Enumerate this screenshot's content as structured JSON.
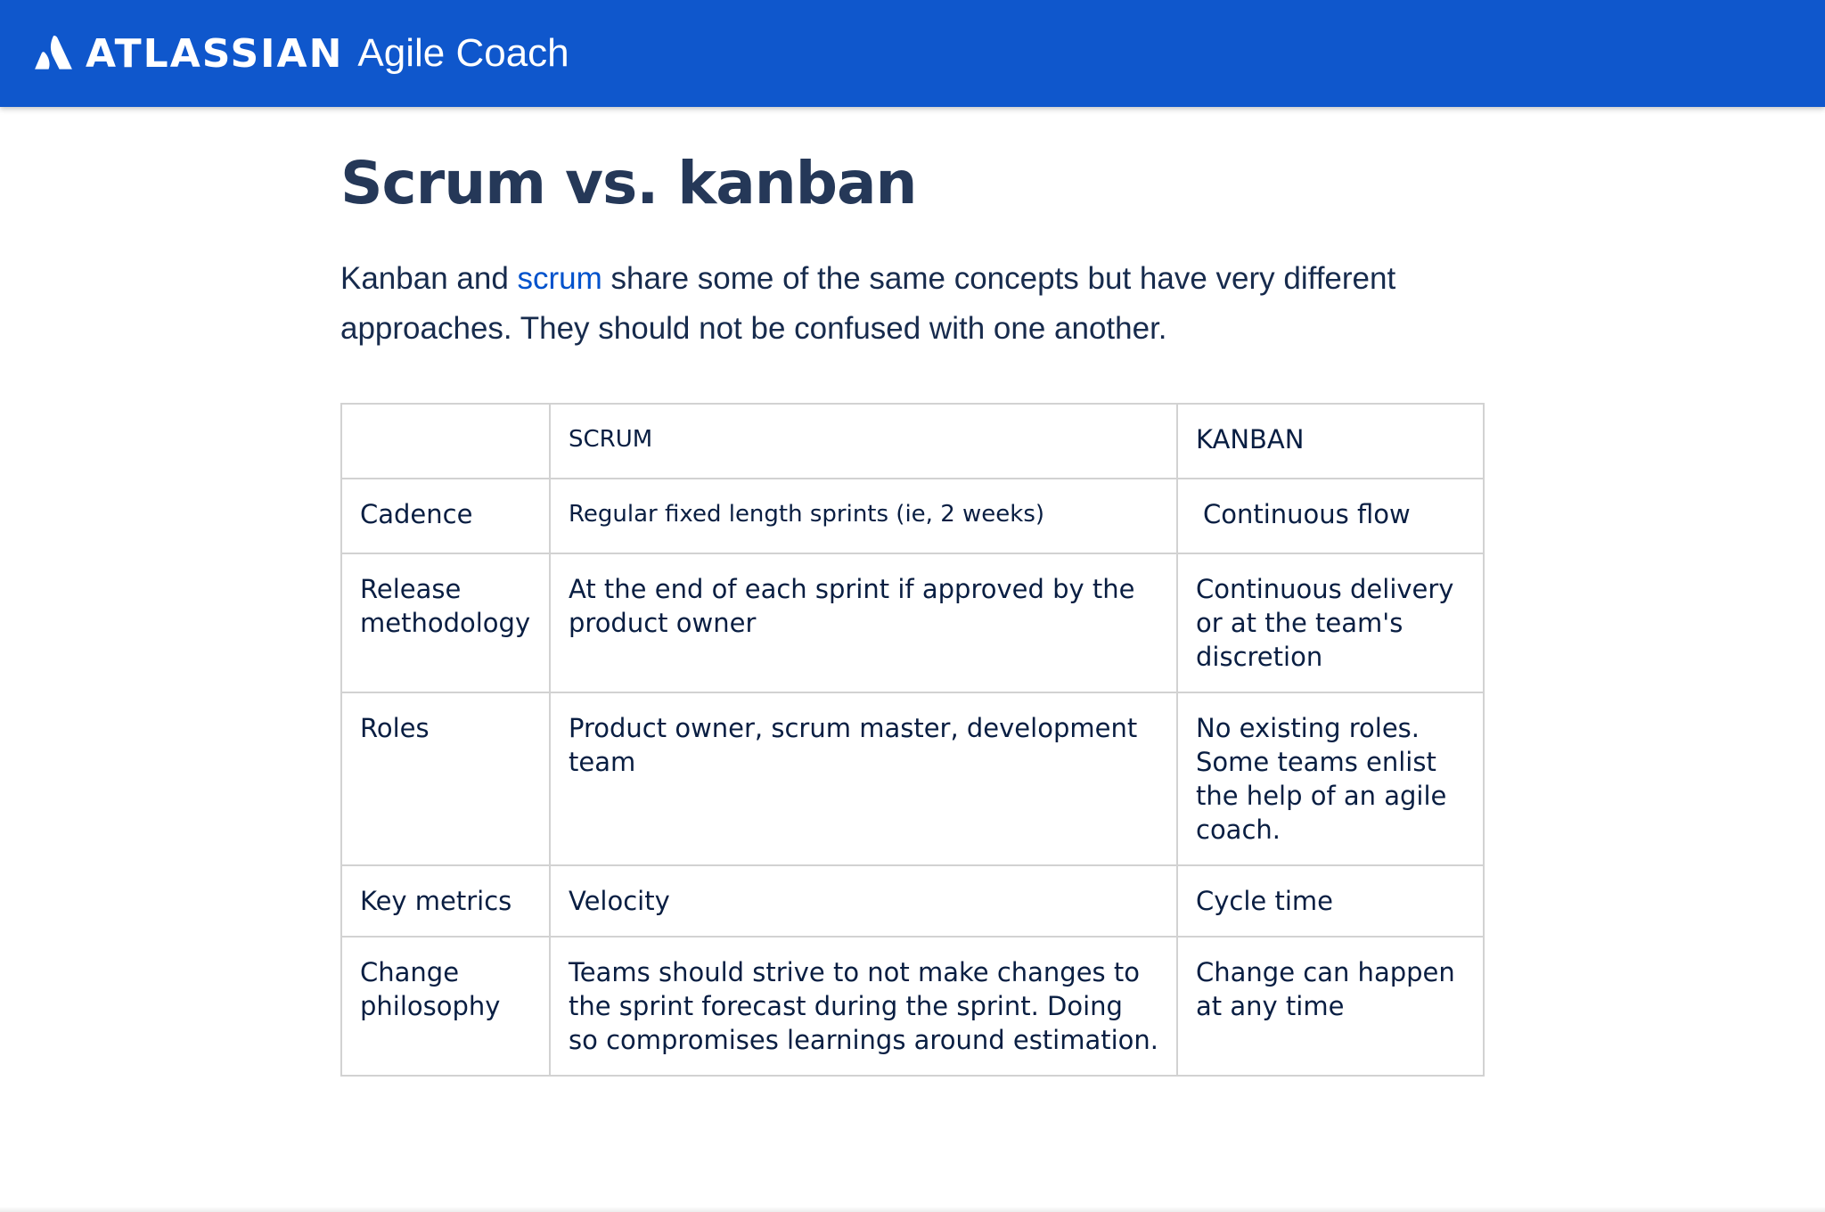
{
  "header": {
    "brand_name": "ATLASSIAN",
    "product_name": "Agile Coach",
    "logo_icon": "atlassian-logo-icon",
    "background_color": "#0f57cc"
  },
  "main": {
    "title": "Scrum vs. kanban",
    "intro": {
      "before_link": "Kanban and ",
      "link_text": "scrum",
      "after_link": " share some of the same concepts but have very different approaches. They should not be confused with one another."
    }
  },
  "table": {
    "headers": [
      "",
      "SCRUM",
      "KANBAN"
    ],
    "rows": [
      [
        "Cadence",
        "Regular fixed length sprints (ie, 2 weeks)",
        "Continuous flow"
      ],
      [
        "Release methodology",
        "At the end of each sprint if approved by the product owner",
        "Continuous delivery or at the team's discretion"
      ],
      [
        "Roles",
        "Product owner, scrum master, development team",
        "No existing roles. Some teams enlist the help of an agile coach."
      ],
      [
        "Key metrics",
        "Velocity",
        "Cycle time"
      ],
      [
        "Change philosophy",
        "Teams should strive to not make changes to the sprint forecast during the sprint. Doing so compromises learnings around estimation.",
        "Change can happen at any time"
      ]
    ]
  }
}
